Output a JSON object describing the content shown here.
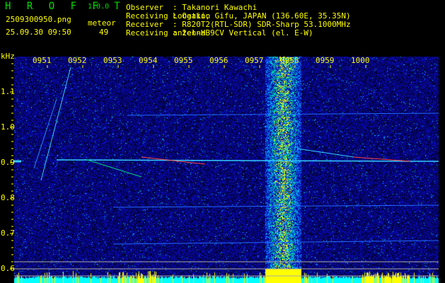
{
  "app": {
    "name": "H R O F F T",
    "version": "1.0.0"
  },
  "file": {
    "name": "2509300950.png",
    "datetime": "25.09.30 09:50"
  },
  "meteor": {
    "label": "meteor",
    "count": "49"
  },
  "info": [
    {
      "key": "Observer",
      "value": ": Takanori Kawachi"
    },
    {
      "key": "Receiving Location",
      "value": ": Ogaki, Gifu, JAPAN (136.60E, 35.35N)"
    },
    {
      "key": "Receiver",
      "value": ": R820T2(RTL-SDR) SDR-Sharp 53.1000MHz"
    },
    {
      "key": "Receiving antenna",
      "value": ": 2el-HB9CV Vertical (el. E-W)"
    }
  ],
  "spectrogram": {
    "y_unit": "kHz",
    "y_ticks": [
      "1.1",
      "1.0",
      "0.9",
      "0.8",
      "0.7",
      "0.6"
    ],
    "time_labels": [
      "0951",
      "0952",
      "0953",
      "0954",
      "0955",
      "0956",
      "0957",
      "0958",
      "0959",
      "1000"
    ]
  },
  "colors": {
    "text": "#ffff00",
    "logo": "#00dd00",
    "bg": "#000000",
    "noise": "#0a0a8a",
    "spectrum_fill": "#00ffff",
    "spectrum_peak": "#ffff00"
  }
}
